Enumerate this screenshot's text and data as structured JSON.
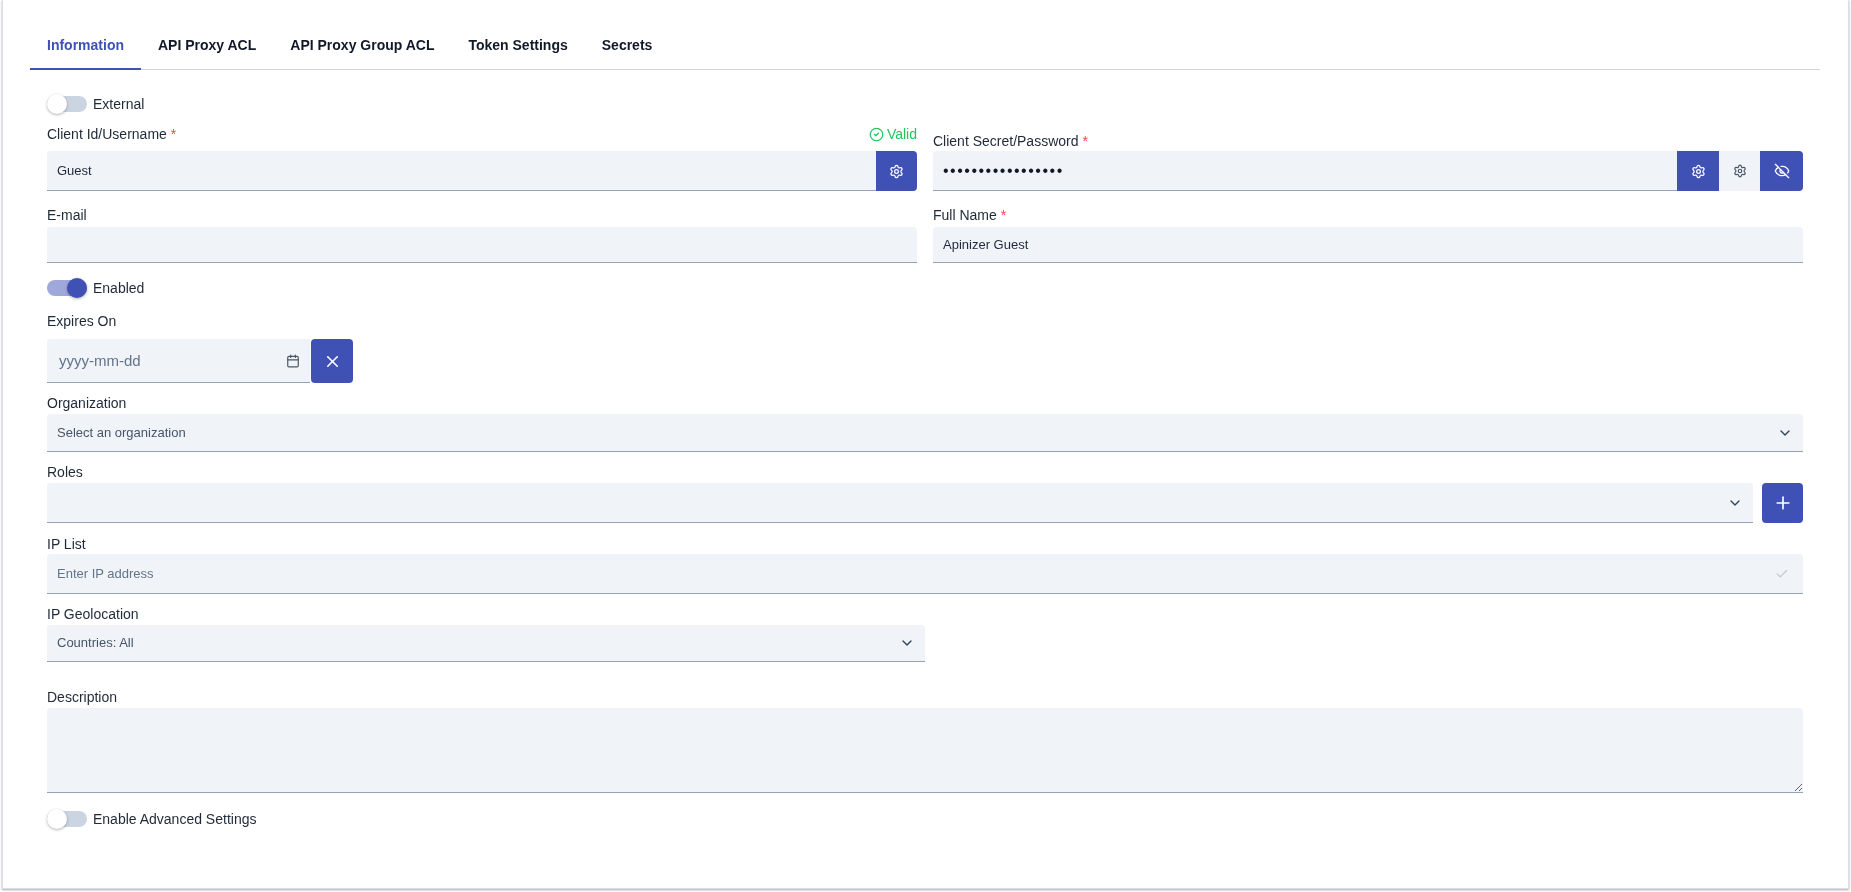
{
  "tabs": [
    {
      "label": "Information",
      "selected": true
    },
    {
      "label": "API Proxy ACL",
      "selected": false
    },
    {
      "label": "API Proxy Group ACL",
      "selected": false
    },
    {
      "label": "Token Settings",
      "selected": false
    },
    {
      "label": "Secrets",
      "selected": false
    }
  ],
  "external": {
    "label": "External",
    "on": false
  },
  "client_id": {
    "label": "Client Id/Username",
    "required_mark": "*",
    "status": "Valid",
    "value": "Guest"
  },
  "client_secret": {
    "label": "Client Secret/Password",
    "required_mark": "*",
    "value": "•••••••••••••••••"
  },
  "email": {
    "label": "E-mail"
  },
  "full_name": {
    "label": "Full Name",
    "required_mark": "*",
    "value": "Apinizer Guest"
  },
  "enabled": {
    "label": "Enabled",
    "on": true
  },
  "expires_on": {
    "label": "Expires On",
    "placeholder": "yyyy-mm-dd"
  },
  "organization": {
    "label": "Organization",
    "placeholder": "Select an organization"
  },
  "roles": {
    "label": "Roles"
  },
  "ip_list": {
    "label": "IP List",
    "placeholder": "Enter IP address"
  },
  "ip_geolocation": {
    "label": "IP Geolocation",
    "value": "Countries: All"
  },
  "description": {
    "label": "Description"
  },
  "advanced_settings": {
    "label": "Enable Advanced Settings",
    "on": false
  }
}
